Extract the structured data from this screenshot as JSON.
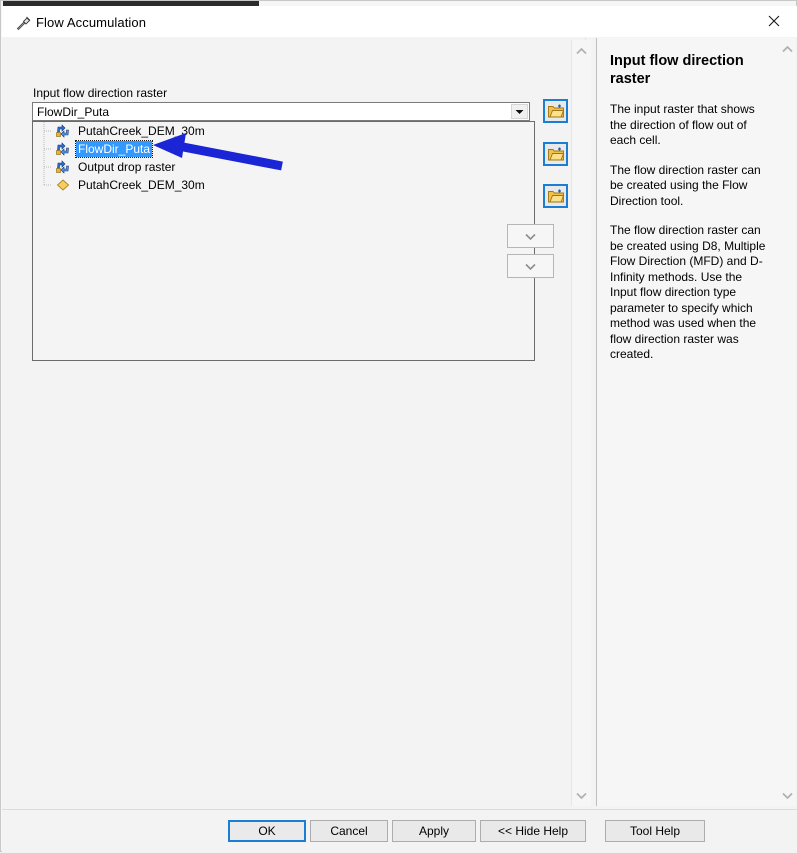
{
  "window": {
    "title": "Flow Accumulation",
    "title_icon": "hammer-tool-icon",
    "close_icon": "close-icon"
  },
  "params": {
    "input_label": "Input flow direction raster",
    "combo_value": "FlowDir_Puta",
    "combo_placeholder": "",
    "dropdown_arrow_icon": "chevron-down-icon",
    "dropdown_items": [
      {
        "label": "PutahCreek_DEM_30m",
        "icon": "raster-layer-icon",
        "selected": false
      },
      {
        "label": "FlowDir_Puta",
        "icon": "raster-layer-icon",
        "selected": true
      },
      {
        "label": "Output drop raster",
        "icon": "raster-layer-icon",
        "selected": false
      },
      {
        "label": "PutahCreek_DEM_30m",
        "icon": "polygon-layer-icon",
        "selected": false
      }
    ],
    "browse_buttons": [
      {
        "name": "browse-input-flow-direction-raster",
        "icon": "open-folder-icon"
      },
      {
        "name": "browse-output-accumulation-raster",
        "icon": "open-folder-icon"
      },
      {
        "name": "browse-input-weight-raster",
        "icon": "open-folder-icon"
      }
    ],
    "hidden_combos": [
      {
        "name": "output-data-type-combo",
        "icon": "chevron-down-icon"
      },
      {
        "name": "input-flow-direction-type-combo",
        "icon": "chevron-down-icon"
      }
    ]
  },
  "scrollbars": {
    "param_up_icon": "chevron-up-icon",
    "param_down_icon": "chevron-down-icon",
    "help_up_icon": "chevron-up-icon",
    "help_down_icon": "chevron-down-icon"
  },
  "help": {
    "title": "Input flow direction raster",
    "paragraphs": [
      "The input raster that shows the direction of flow out of each cell.",
      "The flow direction raster can be created using the Flow Direction tool.",
      "The flow direction raster can be created using D8, Multiple Flow Direction (MFD) and D-Infinity methods. Use the Input flow direction type parameter to specify which method was used when the flow direction raster was created."
    ]
  },
  "footer": {
    "ok": "OK",
    "cancel": "Cancel",
    "apply": "Apply",
    "hide_help": "<< Hide Help",
    "tool_help": "Tool Help"
  },
  "colors": {
    "accent": "#1a7fd4",
    "selection": "#3399ff",
    "window_bg": "#f3f3f3",
    "annotation_arrow": "#1a26d6"
  }
}
